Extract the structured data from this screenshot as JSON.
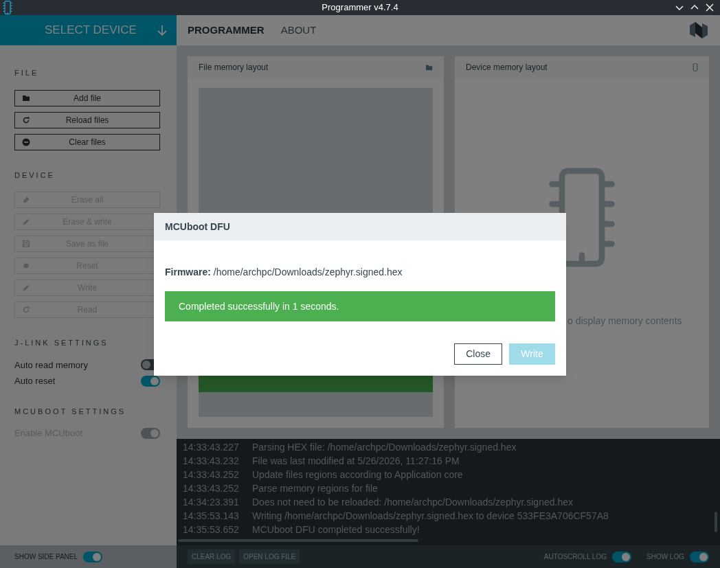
{
  "window": {
    "title": "Programmer v4.7.4"
  },
  "device_selector": {
    "label": "SELECT DEVICE"
  },
  "nav_tabs": [
    {
      "label": "PROGRAMMER",
      "selected": true
    },
    {
      "label": "ABOUT",
      "selected": false
    }
  ],
  "sidebar": {
    "sections": [
      {
        "title": "FILE",
        "items": [
          {
            "kind": "button",
            "label": "Add file",
            "disabled": false
          },
          {
            "kind": "button",
            "label": "Reload files",
            "disabled": false
          },
          {
            "kind": "button",
            "label": "Clear files",
            "disabled": false
          }
        ]
      },
      {
        "title": "DEVICE",
        "items": [
          {
            "kind": "button",
            "label": "Erase all",
            "disabled": true
          },
          {
            "kind": "button",
            "label": "Erase & write",
            "disabled": true
          },
          {
            "kind": "button",
            "label": "Save as file",
            "disabled": true
          },
          {
            "kind": "button",
            "label": "Reset",
            "disabled": true
          },
          {
            "kind": "button",
            "label": "Write",
            "disabled": true
          },
          {
            "kind": "button",
            "label": "Read",
            "disabled": true
          }
        ]
      },
      {
        "title": "J-LINK SETTINGS",
        "items": [
          {
            "kind": "toggle",
            "label": "Auto read memory",
            "on": false,
            "disabled": false
          },
          {
            "kind": "toggle",
            "label": "Auto reset",
            "on": true,
            "disabled": false
          }
        ]
      },
      {
        "title": "MCUBOOT SETTINGS",
        "items": [
          {
            "kind": "toggle",
            "label": "Enable MCUboot",
            "on": true,
            "disabled": true
          }
        ]
      }
    ],
    "footer_toggle": {
      "label": "SHOW SIDE PANEL",
      "on": true
    }
  },
  "file_memory_layout": {
    "title": "File memory layout"
  },
  "device_memory_layout": {
    "title": "Device memory layout",
    "hint": "o display memory contents"
  },
  "log": {
    "entries": [
      {
        "time": "14:33:43.227",
        "message": "Parsing HEX file: /home/archpc/Downloads/zephyr.signed.hex"
      },
      {
        "time": "14:33:43.232",
        "message": "File was last modified at 5/26/2026, 11:27:16 PM"
      },
      {
        "time": "14:33:43.252",
        "message": "Update files regions according to Application core"
      },
      {
        "time": "14:33:43.252",
        "message": "Parse memory regions for file"
      },
      {
        "time": "14:34:23.391",
        "message": "Does not need to be reloaded: /home/archpc/Downloads/zephyr.signed.hex"
      },
      {
        "time": "14:35:53.143",
        "message": "Writing /home/archpc/Downloads/zephyr.signed.hex to device 533FE3A706CF57A8"
      },
      {
        "time": "14:35:53.652",
        "message": "MCUboot DFU completed successfully!"
      }
    ],
    "buttons": [
      "CLEAR LOG",
      "OPEN LOG FILE"
    ],
    "toggles": [
      {
        "label": "AUTOSCROLL LOG",
        "on": true
      },
      {
        "label": "SHOW LOG",
        "on": true
      }
    ]
  },
  "dialog": {
    "title": "MCUboot DFU",
    "firmware": "**Firmware:** /home/archpc/Downloads/zephyr.signed.hex",
    "status": "Completed successfully in 1 seconds.",
    "buttons": [
      {
        "label": "Close",
        "disabled": false
      },
      {
        "label": "Write",
        "disabled": true
      }
    ]
  }
}
